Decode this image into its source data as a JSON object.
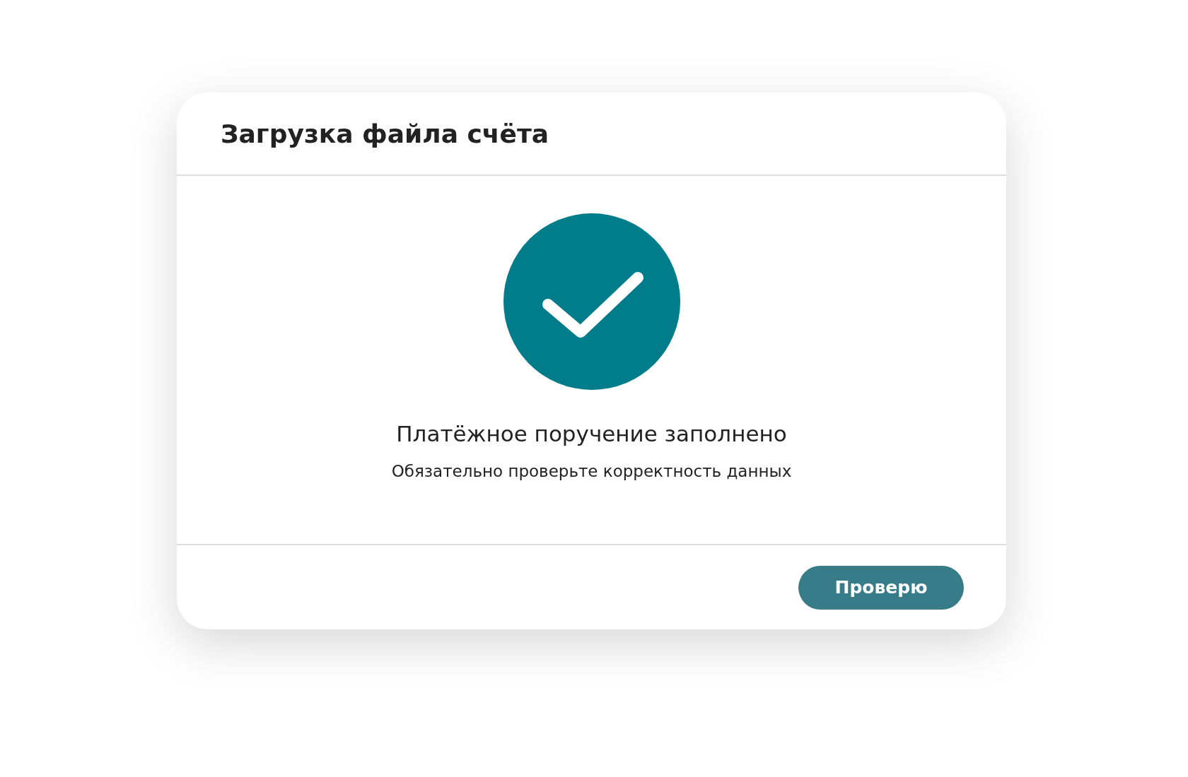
{
  "dialog": {
    "title": "Загрузка файла счёта",
    "status": {
      "kind": "success",
      "heading": "Платёжное поручение заполнено",
      "message": "Обязательно проверьте корректность данных"
    },
    "buttons": [
      {
        "label": "Проверю",
        "kind": "primary"
      }
    ]
  }
}
